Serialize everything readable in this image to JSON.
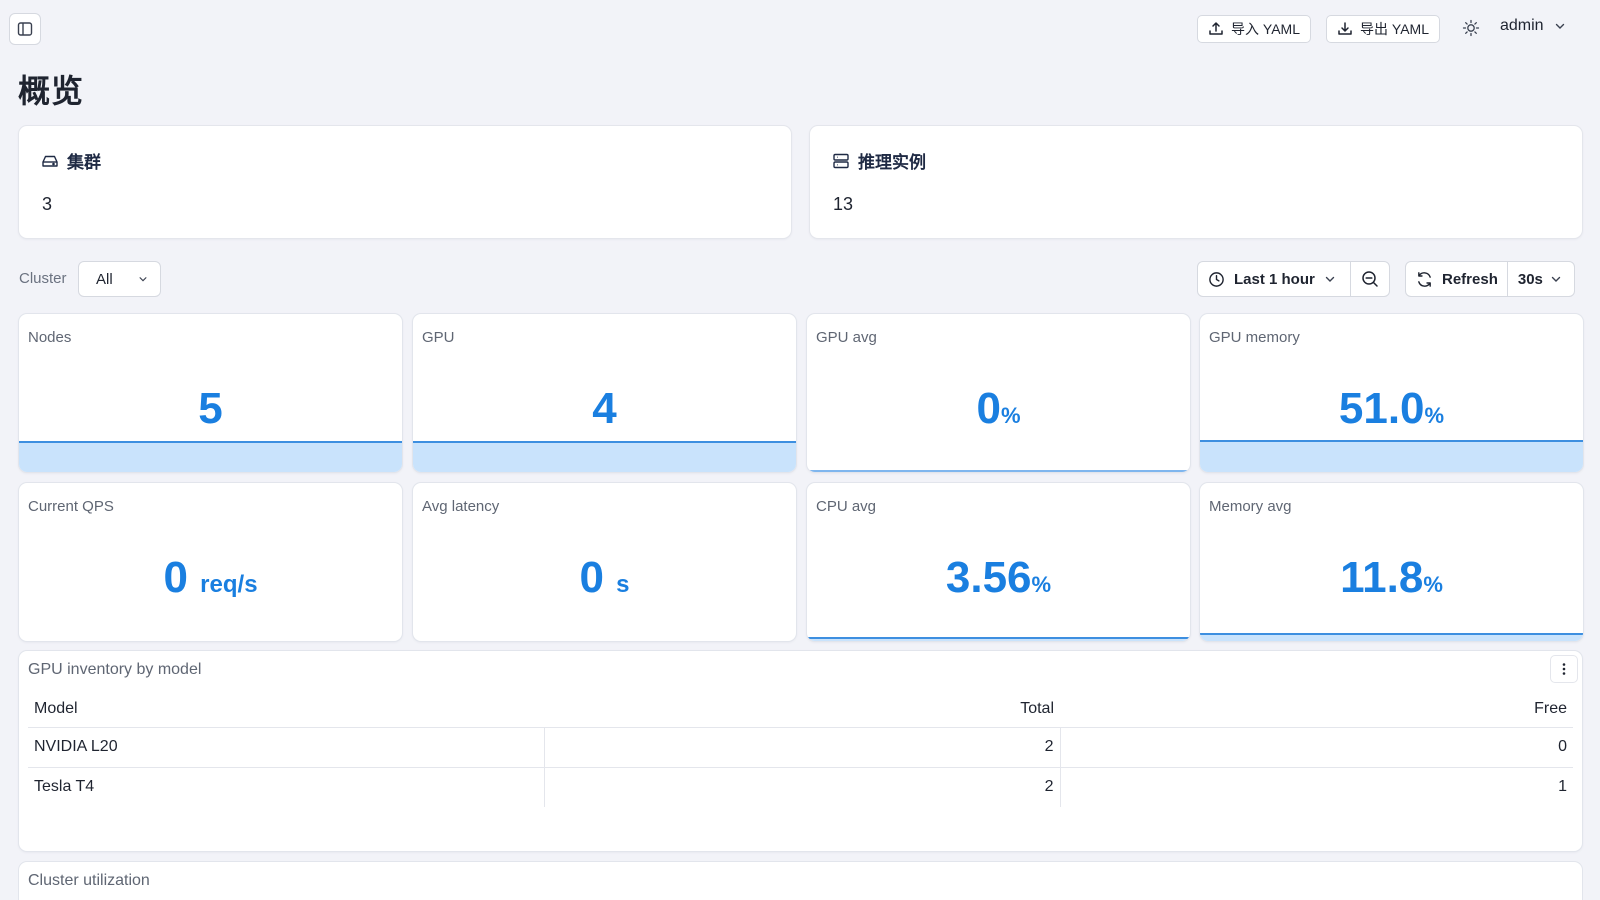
{
  "topbar": {
    "import_label": "导入 YAML",
    "export_label": "导出 YAML",
    "user_name": "admin"
  },
  "page": {
    "title": "概览"
  },
  "summary": [
    {
      "title": "集群",
      "value": "3",
      "icon": "hard-drive-icon"
    },
    {
      "title": "推理实例",
      "value": "13",
      "icon": "server-stack-icon"
    }
  ],
  "filters": {
    "cluster_label": "Cluster",
    "cluster_value": "All",
    "time_range": "Last 1 hour",
    "refresh_label": "Refresh",
    "refresh_interval": "30s"
  },
  "stats": [
    {
      "label": "Nodes",
      "value": "5",
      "unit": ""
    },
    {
      "label": "GPU",
      "value": "4",
      "unit": ""
    },
    {
      "label": "GPU avg",
      "value": "0",
      "unit": "%"
    },
    {
      "label": "GPU memory",
      "value": "51.0",
      "unit": "%"
    },
    {
      "label": "Current QPS",
      "value": "0",
      "unit": "req/s"
    },
    {
      "label": "Avg latency",
      "value": "0",
      "unit": "s"
    },
    {
      "label": "CPU avg",
      "value": "3.56",
      "unit": "%"
    },
    {
      "label": "Memory avg",
      "value": "11.8",
      "unit": "%"
    }
  ],
  "inventory": {
    "title": "GPU inventory by model",
    "columns": [
      "Model",
      "Total",
      "Free"
    ],
    "rows": [
      [
        "NVIDIA L20",
        "2",
        "0"
      ],
      [
        "Tesla T4",
        "2",
        "1"
      ]
    ]
  },
  "utilization": {
    "title": "Cluster utilization"
  },
  "colors": {
    "accent": "#1a7fe0",
    "spark_fill": "#c9e3fc",
    "background": "#f2f3f8"
  }
}
